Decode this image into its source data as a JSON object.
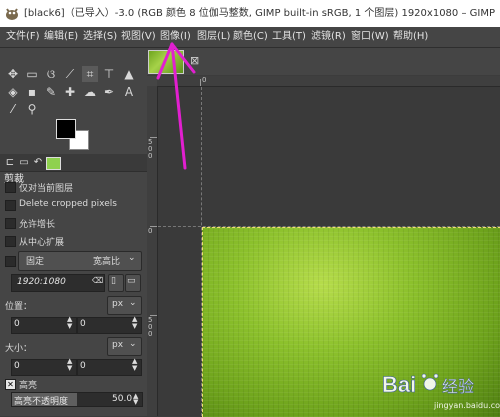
{
  "window": {
    "title": "[black6]（已导入）-3.0 (RGB 颜色 8 位伽马整数, GIMP built-in sRGB, 1 个图层) 1920x1080 – GIMP"
  },
  "menu": {
    "items": [
      "文件(F)",
      "编辑(E)",
      "选择(S)",
      "视图(V)",
      "图像(I)",
      "图层(L)",
      "颜色(C)",
      "工具(T)",
      "滤镜(R)",
      "窗口(W)",
      "帮助(H)"
    ]
  },
  "tool_options": {
    "title": "剪裁",
    "current_layer_only": "仅对当前图层",
    "delete_cropped": "Delete cropped pixels",
    "allow_growing": "允许增长",
    "expand_from_center": "从中心扩展",
    "fixed_label": "固定",
    "fixed_mode": "宽高比",
    "ratio_value": "1920:1080",
    "position_label": "位置：",
    "position_unit": "px",
    "position_x": "0",
    "position_y": "0",
    "size_label": "大小：",
    "size_unit": "px",
    "size_w": "0",
    "size_h": "0",
    "highlight_label": "高亮",
    "highlight_opacity_label": "高亮不透明度",
    "highlight_opacity_value": "50.0",
    "highlight_opacity_fraction": 0.5
  },
  "rulers": {
    "top": [
      "0"
    ],
    "left": [
      "0",
      "500"
    ]
  },
  "icons": {
    "tools": [
      "move-icon",
      "rect-select-icon",
      "lasso-icon",
      "fuzzy-select-icon",
      "crop-icon",
      "transform-icon",
      "text-icon",
      "bucket-fill-icon",
      "blend-icon",
      "paintbrush-icon",
      "clone-icon",
      "smudge-icon",
      "path-icon",
      "eyedropper-icon",
      "zoom-icon"
    ]
  },
  "colors": {
    "foreground": "#000000",
    "background": "#ffffff",
    "annotation_arrow": "#e21fd0"
  },
  "watermark": {
    "brand": "Bai",
    "brand_suffix": "经验",
    "url": "jingyan.baidu.com"
  }
}
